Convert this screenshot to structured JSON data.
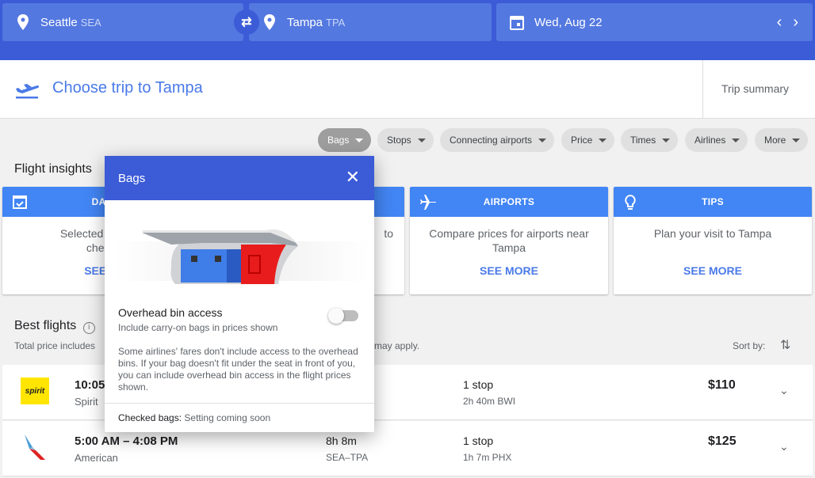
{
  "search": {
    "origin_city": "Seattle",
    "origin_code": "SEA",
    "dest_city": "Tampa",
    "dest_code": "TPA",
    "date": "Wed, Aug 22"
  },
  "header": {
    "title": "Choose trip to Tampa",
    "trip_summary": "Trip summary"
  },
  "filters": [
    {
      "label": "Bags",
      "active": true
    },
    {
      "label": "Stops"
    },
    {
      "label": "Connecting airports"
    },
    {
      "label": "Price"
    },
    {
      "label": "Times"
    },
    {
      "label": "Airlines"
    },
    {
      "label": "More"
    }
  ],
  "insights": {
    "title": "Flight insights",
    "cards": [
      {
        "title": "DAT",
        "body": "Selected dates a\ncheap",
        "link": "SEE M",
        "icon": "calendar-check-icon"
      },
      {
        "title": "",
        "body": "to",
        "link": "",
        "icon": ""
      },
      {
        "title": "AIRPORTS",
        "body": "Compare prices for airports near Tampa",
        "link": "SEE MORE",
        "icon": "airplane-icon"
      },
      {
        "title": "TIPS",
        "body": "Plan your visit to Tampa",
        "link": "SEE MORE",
        "icon": "lightbulb-icon"
      }
    ]
  },
  "best": {
    "title": "Best flights",
    "note_left": "Total price includes",
    "note_right": "may apply.",
    "sort_label": "Sort by:"
  },
  "flights": [
    {
      "times": "10:05",
      "airline": "Spirit",
      "duration": "",
      "route": "",
      "stops": "1 stop",
      "layover": "2h 40m BWI",
      "price": "$110",
      "logo": "spirit"
    },
    {
      "times": "5:00 AM – 4:08 PM",
      "airline": "American",
      "duration": "8h 8m",
      "route": "SEA–TPA",
      "stops": "1 stop",
      "layover": "1h 7m PHX",
      "price": "$125"
    }
  ],
  "bags_dialog": {
    "title": "Bags",
    "option_title": "Overhead bin access",
    "option_sub": "Include carry-on bags in prices shown",
    "toggle_on": false,
    "explain": "Some airlines' fares don't include access to the overhead bins. If your bag doesn't fit under the seat in front of you, you can include overhead bin access in the flight prices shown.",
    "checked_label": "Checked bags:",
    "checked_value": "Setting coming soon"
  },
  "colors": {
    "brand_blue": "#3b5bd7",
    "field": "#5378e0",
    "card_header": "#4285f4",
    "link": "#4a7ae8"
  }
}
